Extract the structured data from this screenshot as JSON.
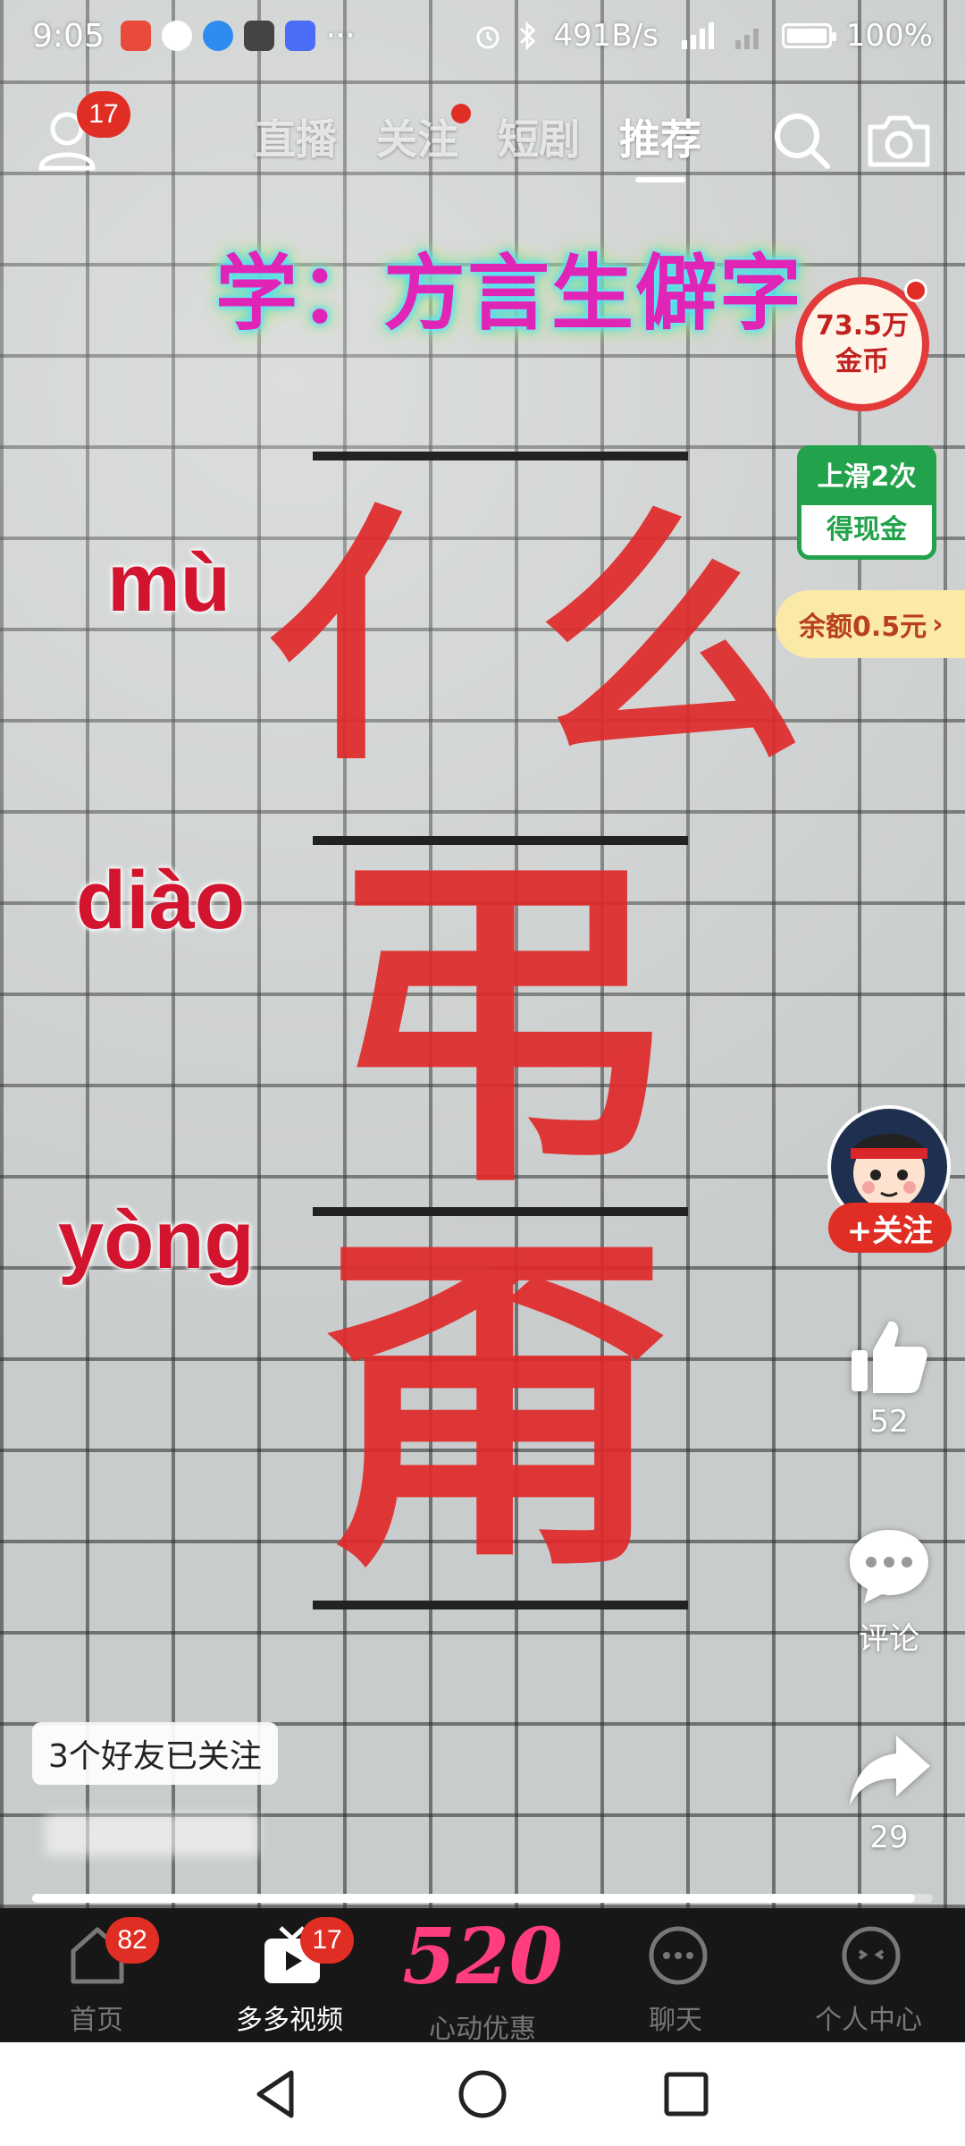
{
  "status_bar": {
    "time": "9:05",
    "more": "···",
    "net_speed": "491B/s",
    "battery": "100%"
  },
  "top_nav": {
    "profile_badge": "17",
    "tabs": [
      "直播",
      "关注",
      "短剧",
      "推荐"
    ],
    "active_tab": "推荐"
  },
  "video": {
    "title": "学：方言生僻字",
    "pinyin": [
      "mù",
      "diào",
      "yòng"
    ],
    "characters": [
      "亻么",
      "弔",
      "甭"
    ]
  },
  "rewards": {
    "coin_amount": "73.5万",
    "coin_label": "金币",
    "cash_top": "上滑2次",
    "cash_bottom": "得现金",
    "balance": "余额0.5元"
  },
  "actions": {
    "follow": "+关注",
    "likes": "52",
    "comment_label": "评论",
    "shares": "29"
  },
  "overlay": {
    "friends_followed": "3个好友已关注",
    "progress": 0.98
  },
  "tab_bar": {
    "items": [
      {
        "label": "首页",
        "badge": "82"
      },
      {
        "label": "多多视频",
        "badge": "17"
      },
      {
        "label": "心动优惠",
        "promo": "520"
      },
      {
        "label": "聊天"
      },
      {
        "label": "个人中心"
      }
    ],
    "active": "多多视频"
  },
  "colors": {
    "accent_red": "#e02e24",
    "cash_green": "#22a24a",
    "promo_pink": "#ff3d7f"
  }
}
